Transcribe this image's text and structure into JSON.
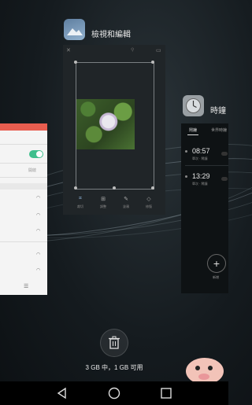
{
  "recents": {
    "gallery": {
      "title": "檢視和編輯",
      "tools": [
        {
          "icon": "crop-icon",
          "label": "裁切"
        },
        {
          "icon": "adjust-icon",
          "label": "調整"
        },
        {
          "icon": "draw-icon",
          "label": "塗鴉"
        },
        {
          "icon": "erase-icon",
          "label": "修復"
        }
      ]
    },
    "clock": {
      "title": "時鐘",
      "tabs": [
        "鬧鐘",
        "世界時鐘"
      ],
      "alarms": [
        {
          "time": "08:57",
          "sub": "單次 · 鬧鐘"
        },
        {
          "time": "13:29",
          "sub": "單次 · 鬧鐘"
        }
      ],
      "add_label": "新增"
    },
    "settings": {
      "row_value": "開啟"
    }
  },
  "memory_text": "3 GB 中，1 GB 可用",
  "colors": {
    "toggle": "#3fbf8d",
    "settings_bar": "#e85d4f",
    "background": "#151b1f"
  },
  "navbar": {
    "back": "back-icon",
    "home": "home-icon",
    "recents": "recents-icon"
  }
}
